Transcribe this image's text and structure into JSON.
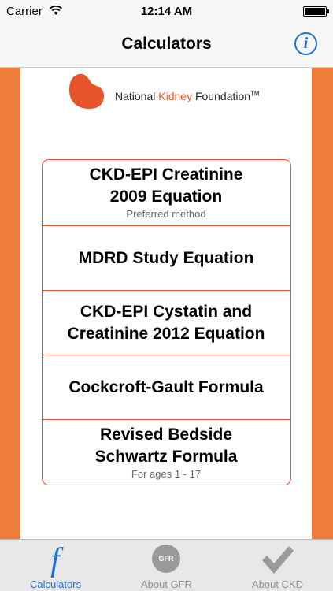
{
  "status_bar": {
    "carrier": "Carrier",
    "time": "12:14 AM"
  },
  "nav": {
    "title": "Calculators"
  },
  "logo": {
    "name_part1": "National ",
    "name_part2": "Kidney",
    "name_part3": " Foundation",
    "trademark": "TM"
  },
  "menu": {
    "items": [
      {
        "line1": "CKD-EPI Creatinine",
        "line2": "2009 Equation",
        "sub": "Preferred method"
      },
      {
        "line1": "MDRD Study Equation",
        "line2": "",
        "sub": ""
      },
      {
        "line1": "CKD-EPI Cystatin and",
        "line2": "Creatinine 2012 Equation",
        "sub": ""
      },
      {
        "line1": "Cockcroft-Gault Formula",
        "line2": "",
        "sub": ""
      },
      {
        "line1": "Revised Bedside",
        "line2": "Schwartz Formula",
        "sub": "For ages 1 - 17"
      }
    ]
  },
  "tabs": [
    {
      "label": "Calculators",
      "icon": "function-icon",
      "glyph": "f"
    },
    {
      "label": "About GFR",
      "icon": "gfr-icon",
      "glyph": "GFR"
    },
    {
      "label": "About CKD",
      "icon": "checkmark-icon"
    }
  ],
  "colors": {
    "accent_orange": "#f07c3c",
    "nkf_red": "#e8542b",
    "ios_blue": "#1a73d9"
  }
}
